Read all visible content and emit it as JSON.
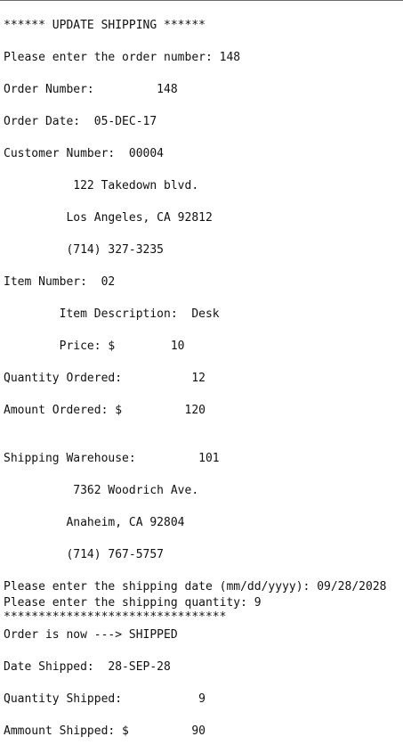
{
  "console": {
    "header": "****** UPDATE SHIPPING ******",
    "prompt_order_number": "Please enter the order number: 148",
    "order_number_line": "Order Number:         148",
    "order_date_line": "Order Date:  05-DEC-17",
    "customer_number_line": "Customer Number:  00004",
    "customer_address_street": "          122 Takedown blvd.",
    "customer_address_city": "         Los Angeles, CA 92812",
    "customer_phone": "         (714) 327-3235",
    "item_number_line": "Item Number:  02",
    "item_description_line": "        Item Description:  Desk",
    "price_line": "        Price: $        10",
    "quantity_ordered_line": "Quantity Ordered:          12",
    "amount_ordered_line": "Amount Ordered: $         120",
    "shipping_warehouse_line": "Shipping Warehouse:         101",
    "warehouse_address_street": "          7362 Woodrich Ave.",
    "warehouse_address_city": "         Anaheim, CA 92804",
    "warehouse_phone": "         (714) 767-5757",
    "prompt_shipping_date": "Please enter the shipping date (mm/dd/yyyy): 09/28/2028",
    "prompt_shipping_quantity": "Please enter the shipping quantity: 9",
    "separator": "********************************",
    "status_line": "Order is now ---> SHIPPED",
    "date_shipped_line": "Date Shipped:  28-SEP-28",
    "quantity_shipped_line": "Quantity Shipped:           9",
    "amount_shipped_line": "Ammount Shipped: $         90"
  }
}
